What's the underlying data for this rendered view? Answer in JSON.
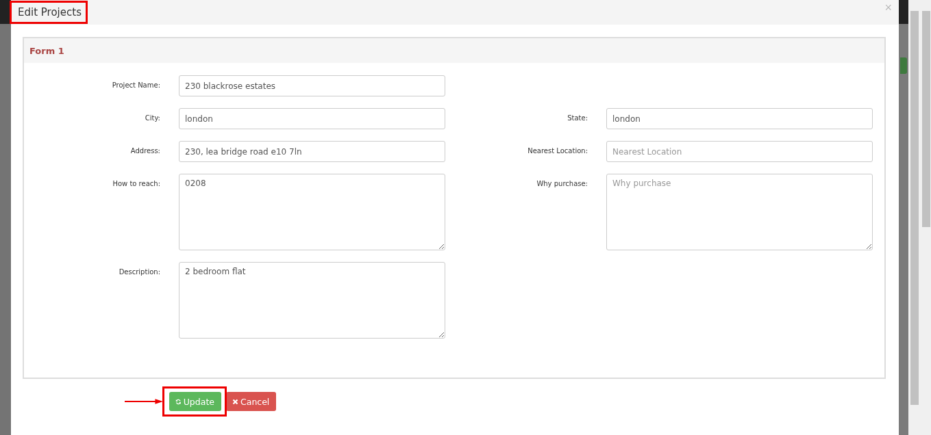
{
  "modal": {
    "title": "Edit Projects",
    "close": "×"
  },
  "panel": {
    "title": "Form 1"
  },
  "rows": [
    {
      "fields": [
        {
          "kind": "input",
          "label": "Project Name:",
          "value": "230 blackrose estates"
        }
      ]
    },
    {
      "fields": [
        {
          "kind": "input",
          "label": "City:",
          "value": "london"
        },
        {
          "kind": "input",
          "label": "State:",
          "value": "london"
        }
      ]
    },
    {
      "fields": [
        {
          "kind": "input",
          "label": "Address:",
          "value": "230, lea bridge road e10 7ln"
        },
        {
          "kind": "input",
          "label": "Nearest Location:",
          "placeholder": "Nearest Location"
        }
      ]
    },
    {
      "fields": [
        {
          "kind": "textarea",
          "label": "How to reach:",
          "value": "0208"
        },
        {
          "kind": "textarea",
          "label": "Why purchase:",
          "placeholder": "Why purchase"
        }
      ]
    },
    {
      "fields": [
        {
          "kind": "textarea",
          "label": "Description:",
          "value": "2 bedroom flat"
        }
      ]
    }
  ],
  "buttons": [
    {
      "kind": "update",
      "label": "Update"
    },
    {
      "kind": "cancel",
      "label": "Cancel"
    }
  ]
}
